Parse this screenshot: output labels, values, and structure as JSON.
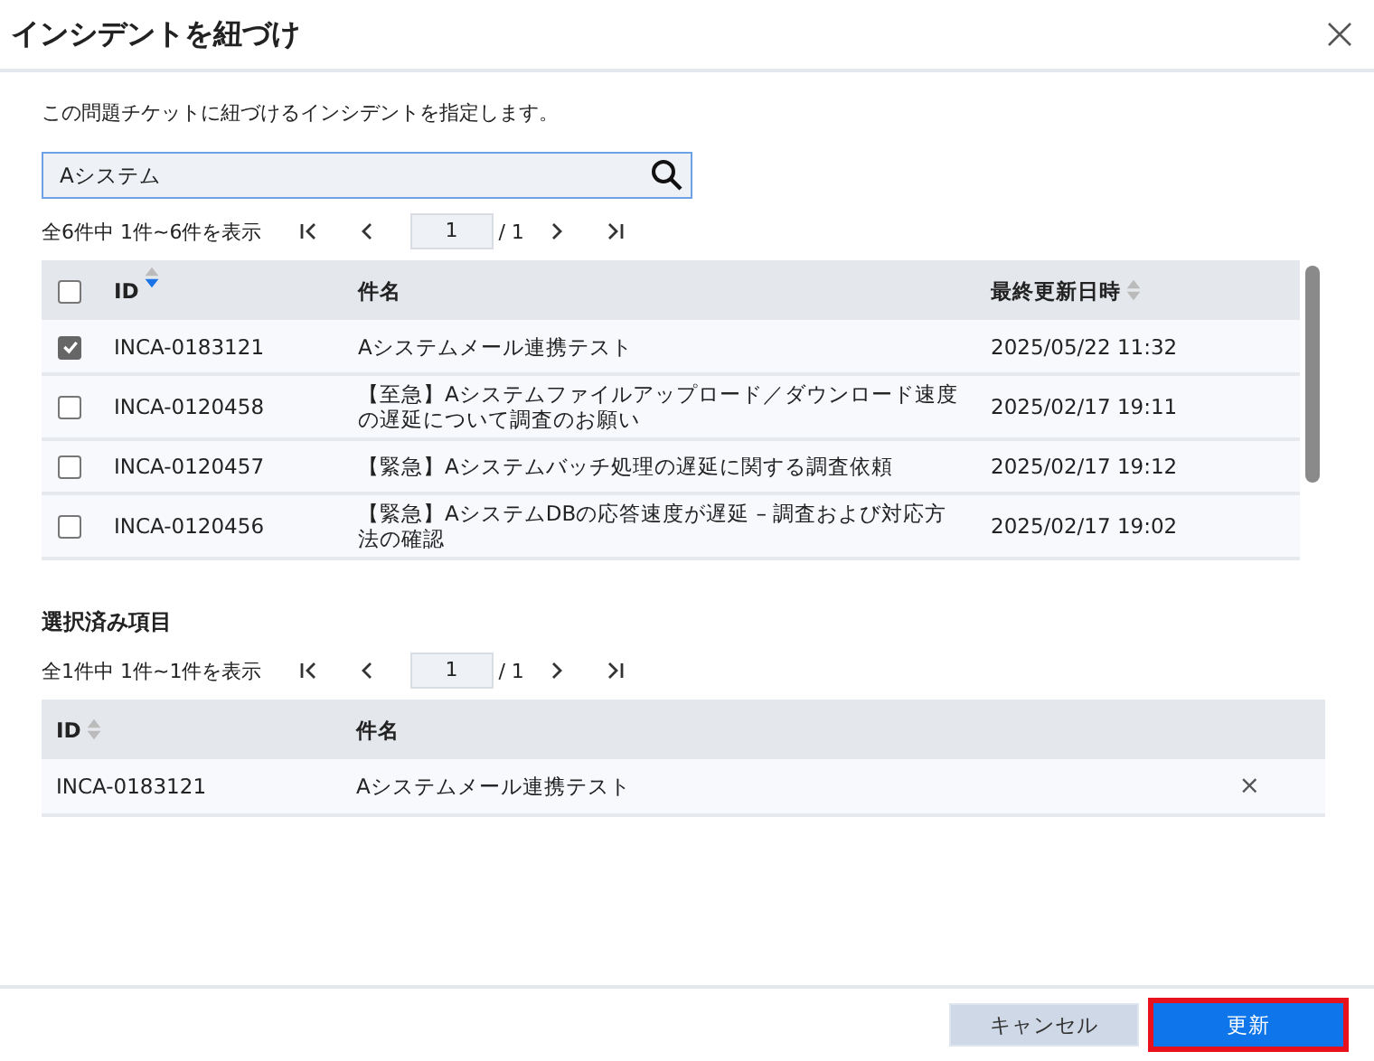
{
  "dialog": {
    "title": "インシデントを紐づけ",
    "description": "この問題チケットに紐づけるインシデントを指定します。"
  },
  "search": {
    "value": "Aシステム"
  },
  "results": {
    "pager": {
      "summary": "全6件中 1件~6件を表示",
      "page": "1",
      "total": "/ 1"
    },
    "columns": [
      {
        "label": "ID",
        "sortable": true,
        "sorted_descending": true
      },
      {
        "label": "件名",
        "sortable": false
      },
      {
        "label": "最終更新日時",
        "sortable": true,
        "sorted_descending": false
      }
    ],
    "all_checked": false,
    "rows": [
      {
        "checked": true,
        "id": "INCA-0183121",
        "title": "Aシステムメール連携テスト",
        "updated": "2025/05/22 11:32"
      },
      {
        "checked": false,
        "id": "INCA-0120458",
        "title": "【至急】Aシステムファイルアップロード／ダウンロード速度の遅延について調査のお願い",
        "updated": "2025/02/17 19:11"
      },
      {
        "checked": false,
        "id": "INCA-0120457",
        "title": "【緊急】Aシステムバッチ処理の遅延に関する調査依頼",
        "updated": "2025/02/17 19:12"
      },
      {
        "checked": false,
        "id": "INCA-0120456",
        "title": "【緊急】AシステムDBの応答速度が遅延 – 調査および対応方法の確認",
        "updated": "2025/02/17 19:02"
      }
    ]
  },
  "selected": {
    "heading": "選択済み項目",
    "pager": {
      "summary": "全1件中 1件~1件を表示",
      "page": "1",
      "total": "/ 1"
    },
    "columns": [
      {
        "label": "ID",
        "sortable": true,
        "sorted_descending": false
      },
      {
        "label": "件名",
        "sortable": false
      }
    ],
    "rows": [
      {
        "id": "INCA-0183121",
        "title": "Aシステムメール連携テスト",
        "remove": "×"
      }
    ]
  },
  "buttons": [
    {
      "label": "キャンセル",
      "kind": "secondary",
      "highlighted": false
    },
    {
      "label": "更新",
      "kind": "primary",
      "highlighted": true
    }
  ]
}
